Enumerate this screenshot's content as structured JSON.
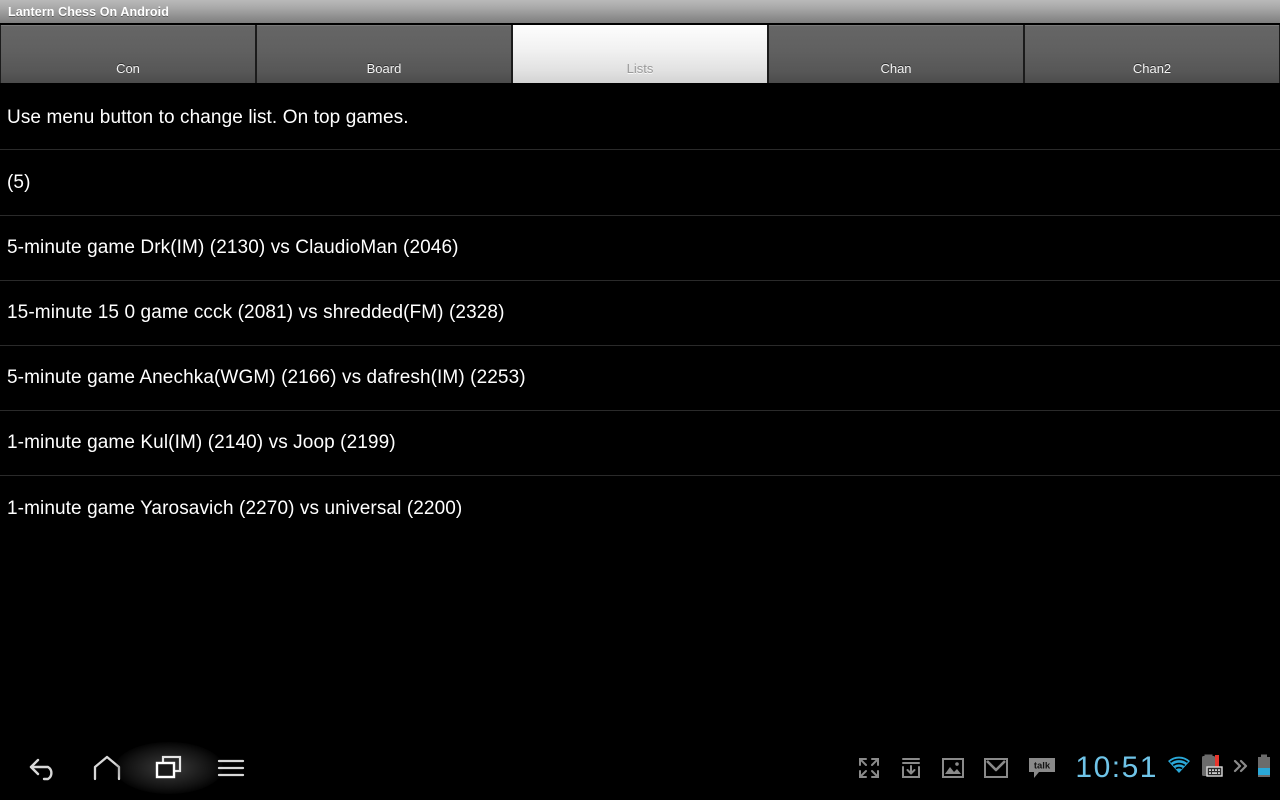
{
  "window": {
    "title": "Lantern Chess On Android"
  },
  "tabs": [
    {
      "label": "Con",
      "active": false
    },
    {
      "label": "Board",
      "active": false
    },
    {
      "label": "Lists",
      "active": true
    },
    {
      "label": "Chan",
      "active": false
    },
    {
      "label": "Chan2",
      "active": false
    }
  ],
  "list": {
    "header": "Use menu button to change list. On top games.",
    "count": "(5)",
    "items": [
      "5-minute game Drk(IM) (2130) vs ClaudioMan (2046)",
      "15-minute 15 0 game ccck (2081) vs shredded(FM) (2328)",
      "5-minute game Anechka(WGM) (2166) vs dafresh(IM) (2253)",
      "1-minute game Kul(IM) (2140) vs Joop (2199)",
      "1-minute game Yarosavich (2270) vs universal (2200)"
    ]
  },
  "system_bar": {
    "nav": [
      {
        "name": "back-icon",
        "label": "Back"
      },
      {
        "name": "home-icon",
        "label": "Home"
      },
      {
        "name": "recents-icon",
        "label": "Recent apps"
      },
      {
        "name": "menu-icon",
        "label": "Menu"
      }
    ],
    "notifications": [
      {
        "name": "fullscreen-icon",
        "label": "Fullscreen"
      },
      {
        "name": "download-icon",
        "label": "Download"
      },
      {
        "name": "gallery-icon",
        "label": "Gallery"
      },
      {
        "name": "gmail-icon",
        "label": "Gmail"
      },
      {
        "name": "talk-icon",
        "label": "talk"
      }
    ],
    "clock": "10:51",
    "status": [
      {
        "name": "wifi-icon",
        "label": "Wi-Fi"
      },
      {
        "name": "keyboard-alert-icon",
        "label": "Keyboard alert"
      },
      {
        "name": "more-icon",
        "label": "More"
      },
      {
        "name": "battery-icon",
        "label": "Battery"
      }
    ]
  },
  "colors": {
    "background": "#000000",
    "titlebar_top": "#b9b9b9",
    "tab_inactive": "#606060",
    "tab_active": "#f2f2f2",
    "text": "#ffffff",
    "clock": "#6fc4e8",
    "wifi": "#3ab7e0",
    "alert": "#e8352c"
  }
}
